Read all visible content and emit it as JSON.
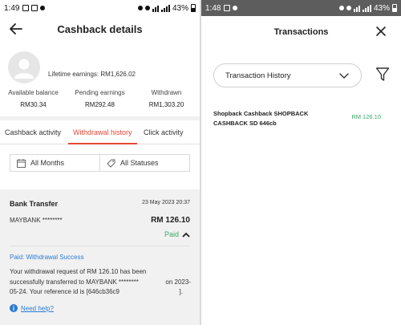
{
  "left": {
    "status_bar": {
      "time": "1:49",
      "battery": "43%"
    },
    "header": {
      "title": "Cashback details"
    },
    "profile": {
      "lifetime_label": "Lifetime earnings:",
      "lifetime_value": "RM1,626.02",
      "stats": [
        {
          "label": "Available balance",
          "value": "RM30.34"
        },
        {
          "label": "Pending earnings",
          "value": "RM292.48"
        },
        {
          "label": "Withdrawn",
          "value": "RM1,303.20"
        }
      ]
    },
    "tabs": [
      {
        "label": "Cashback activity",
        "active": false
      },
      {
        "label": "Withdrawal history",
        "active": true
      },
      {
        "label": "Click activity",
        "active": false
      }
    ],
    "filters": {
      "months": "All Months",
      "statuses": "All Statuses"
    },
    "transfer": {
      "title": "Bank Transfer",
      "date": "23 May 2023 20:37",
      "bank": "MAYBANK ********",
      "amount": "RM 126.10",
      "status": "Paid",
      "status_title": "Paid: Withdrawal Success",
      "message_l1": "Your withdrawal request of RM 126.10 has been",
      "message_l2a": "successfully transferred to MAYBANK ********",
      "message_l2b": "on 2023-",
      "message_l3a": "05-24. Your reference id is [646cb36c9",
      "message_l3b": "].",
      "help": "Need help?"
    }
  },
  "right": {
    "status_bar": {
      "time": "1:48",
      "battery": "43%"
    },
    "header": {
      "title": "Transactions"
    },
    "dropdown": {
      "value": "Transaction History"
    },
    "transactions": [
      {
        "description": "Shopback Cashback SHOPBACK CASHBACK SD 646cb",
        "amount": "RM 126.10"
      }
    ]
  },
  "colors": {
    "accent": "#e24a36",
    "paid_green": "#3aa86b",
    "link_blue": "#2b7bd1"
  }
}
